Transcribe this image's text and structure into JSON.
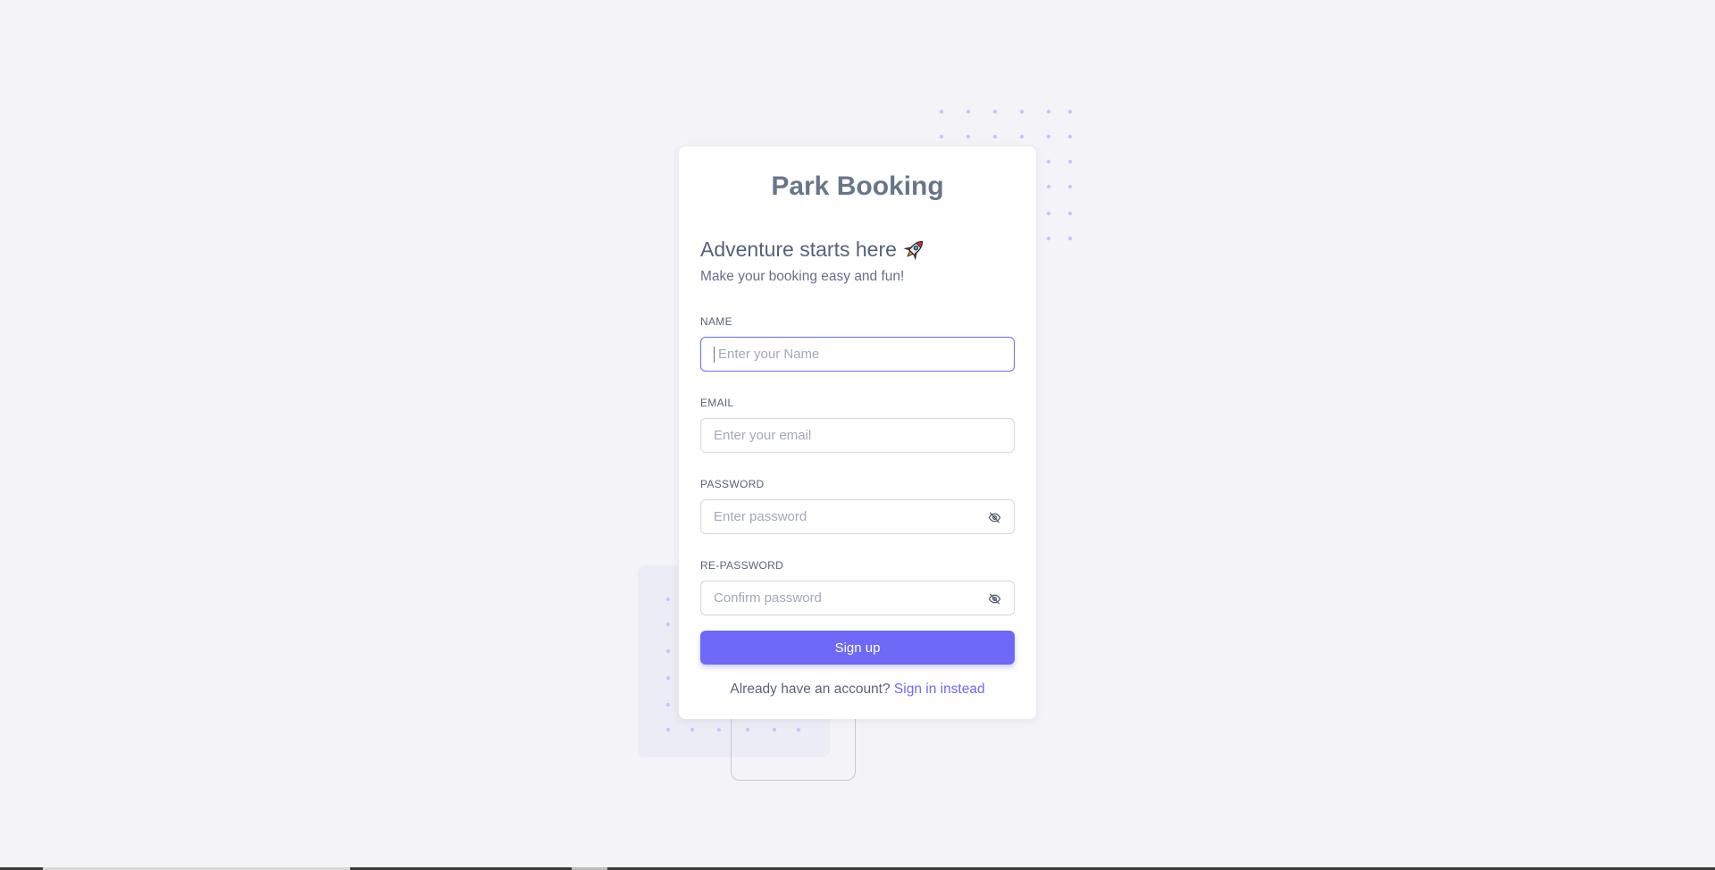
{
  "app": {
    "brand": "Park Booking"
  },
  "hero": {
    "heading": "Adventure starts here",
    "heading_icon": "rocket-emoji",
    "subtitle": "Make your booking easy and fun!"
  },
  "form": {
    "name": {
      "label": "NAME",
      "placeholder": "Enter your Name",
      "value": ""
    },
    "email": {
      "label": "EMAIL",
      "placeholder": "Enter your email",
      "value": ""
    },
    "password": {
      "label": "PASSWORD",
      "placeholder": "Enter password",
      "value": "",
      "toggle_icon": "eye-off-icon"
    },
    "repassword": {
      "label": "RE-PASSWORD",
      "placeholder": "Confirm password",
      "value": "",
      "toggle_icon": "eye-off-icon"
    },
    "submit_label": "Sign up"
  },
  "footer": {
    "prompt": "Already have an account?",
    "link": "Sign in instead"
  },
  "colors": {
    "primary": "#6d69f6",
    "background": "#f4f4f8",
    "card": "#ffffff",
    "brand_text": "#67768d"
  }
}
